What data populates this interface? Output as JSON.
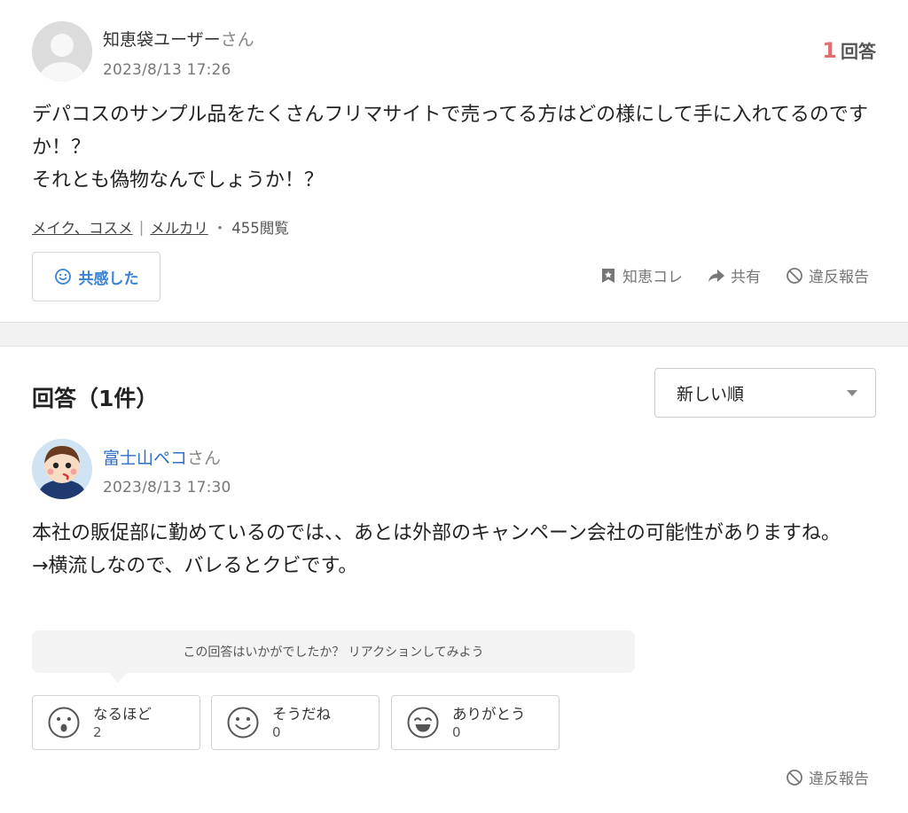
{
  "question": {
    "user_name": "知恵袋ユーザー",
    "user_suffix": "さん",
    "date": "2023/8/13 17:26",
    "answer_count_num": "1",
    "answer_count_label": "回答",
    "body": "デパコスのサンプル品をたくさんフリマサイトで売ってる方はどの様にして手に入れてるのですか！？\nそれとも偽物なんでしょうか！？",
    "tags": [
      "メイク、コスメ",
      "メルカリ"
    ],
    "tag_separator": "|",
    "dot": "・",
    "views": "455閲覧",
    "empathy_button": "共感した",
    "actions": {
      "save": "知恵コレ",
      "share": "共有",
      "report": "違反報告"
    }
  },
  "answers": {
    "title": "回答（1件）",
    "sort": {
      "selected": "新しい順"
    },
    "items": [
      {
        "user_name": "富士山ペコ",
        "user_suffix": "さん",
        "date": "2023/8/13 17:30",
        "body": "本社の販促部に勤めているのでは、、あとは外部のキャンペーン会社の可能性がありますね。\n→横流しなので、バレるとクビです。",
        "reaction_prompt": "この回答はいかがでしたか？ リアクションしてみよう",
        "reactions": [
          {
            "label": "なるほど",
            "count": "2",
            "icon": "surprised-face-icon"
          },
          {
            "label": "そうだね",
            "count": "0",
            "icon": "smile-face-icon"
          },
          {
            "label": "ありがとう",
            "count": "0",
            "icon": "grin-face-icon"
          }
        ],
        "report": "違反報告"
      }
    ]
  },
  "colors": {
    "link_blue": "#2f6fc8",
    "accent_red": "#e0706f",
    "empathy_blue": "#3b82d6"
  }
}
